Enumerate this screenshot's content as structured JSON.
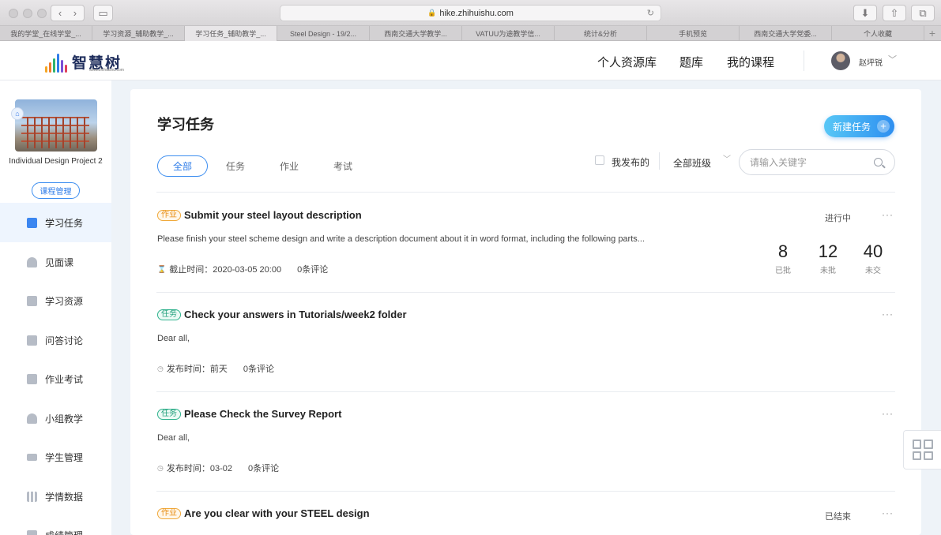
{
  "browser": {
    "url": "hike.zhihuishu.com",
    "tabs": [
      {
        "label": "我的学堂_在线学堂_...",
        "active": false
      },
      {
        "label": "学习资源_辅助教学_...",
        "active": false
      },
      {
        "label": "学习任务_辅助教学_...",
        "active": true
      },
      {
        "label": "Steel Design - 19/2...",
        "active": false
      },
      {
        "label": "西南交通大学教学...",
        "active": false
      },
      {
        "label": "VATUU为途教学信...",
        "active": false
      },
      {
        "label": "统计&分析",
        "active": false
      },
      {
        "label": "手机预览",
        "active": false
      },
      {
        "label": "西南交通大学党委...",
        "active": false
      },
      {
        "label": "个人收藏",
        "active": false
      }
    ]
  },
  "header": {
    "logo_text": "智慧树",
    "logo_url": "www.zhihuishu.com",
    "nav": [
      "个人资源库",
      "题库",
      "我的课程"
    ],
    "user_name": "赵坪锐"
  },
  "sidebar": {
    "course_name": "Individual Design Project 2",
    "course_mgmt_label": "课程管理",
    "items": [
      {
        "label": "学习任务",
        "icon": "task-icon",
        "active": true
      },
      {
        "label": "见面课",
        "icon": "meeting-icon",
        "active": false
      },
      {
        "label": "学习资源",
        "icon": "resource-icon",
        "active": false
      },
      {
        "label": "问答讨论",
        "icon": "discussion-icon",
        "active": false
      },
      {
        "label": "作业考试",
        "icon": "book-icon",
        "active": false
      },
      {
        "label": "小组教学",
        "icon": "group-icon",
        "active": false
      },
      {
        "label": "学生管理",
        "icon": "graduation-cap-icon",
        "active": false
      },
      {
        "label": "学情数据",
        "icon": "bar-chart-icon",
        "active": false
      },
      {
        "label": "成绩管理",
        "icon": "grade-icon",
        "active": false
      }
    ]
  },
  "main": {
    "title": "学习任务",
    "new_task_label": "新建任务",
    "filter_tabs": [
      "全部",
      "任务",
      "作业",
      "考试"
    ],
    "my_published_label": "我发布的",
    "class_select": "全部班级",
    "search_placeholder": "请输入关键字",
    "tasks": [
      {
        "badge": "作业",
        "title": "Submit your steel layout description",
        "desc": "Please finish your steel scheme design and write a description document about it in word format, including the following parts...",
        "meta": "截止时间：2020-03-05 20:00",
        "comments": "0条评论",
        "status": "进行中",
        "stats": [
          {
            "num": "8",
            "label": "已批"
          },
          {
            "num": "12",
            "label": "未批"
          },
          {
            "num": "40",
            "label": "未交"
          }
        ]
      },
      {
        "badge": "任务",
        "title": "Check your answers in Tutorials/week2 folder",
        "desc": "Dear all,",
        "meta": "发布时间：前天",
        "comments": "0条评论",
        "status": ""
      },
      {
        "badge": "任务",
        "title": "Please Check the Survey Report",
        "desc": "Dear all,",
        "meta": "发布时间：03-02",
        "comments": "0条评论",
        "status": ""
      },
      {
        "badge": "作业",
        "title": "Are you clear with your STEEL design",
        "desc": "",
        "meta": "",
        "comments": "",
        "status": "已结束"
      }
    ],
    "more_label": "···"
  },
  "colors": {
    "accent": "#2f7de9",
    "homework_badge": "#e8901a",
    "task_badge": "#22a07c"
  }
}
